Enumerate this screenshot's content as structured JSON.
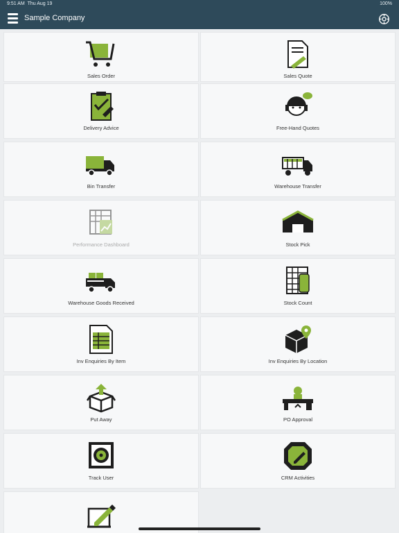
{
  "status": {
    "time": "9:51 AM",
    "date": "Thu Aug 19",
    "battery": "100%"
  },
  "header": {
    "title": "Sample Company"
  },
  "tiles": [
    {
      "label": "Sales Order",
      "icon": "cart-icon"
    },
    {
      "label": "Sales Quote",
      "icon": "quote-document-icon"
    },
    {
      "label": "Delivery Advice",
      "icon": "clipboard-checklist-icon"
    },
    {
      "label": "Free-Hand Quotes",
      "icon": "headset-operator-icon"
    },
    {
      "label": "Bin Transfer",
      "icon": "truck-icon"
    },
    {
      "label": "Warehouse Transfer",
      "icon": "container-truck-icon"
    },
    {
      "label": "Performance Dashboard",
      "icon": "dashboard-chart-icon"
    },
    {
      "label": "Stock Pick",
      "icon": "warehouse-icon"
    },
    {
      "label": "Warehouse Goods Received",
      "icon": "delivery-truck-boxes-icon"
    },
    {
      "label": "Stock Count",
      "icon": "stock-count-sheet-icon"
    },
    {
      "label": "Inv Enquiries By Item",
      "icon": "item-document-icon"
    },
    {
      "label": "Inv Enquiries By Location",
      "icon": "box-location-pin-icon"
    },
    {
      "label": "Put Away",
      "icon": "open-box-arrow-icon"
    },
    {
      "label": "PO Approval",
      "icon": "desk-person-icon"
    },
    {
      "label": "Track User",
      "icon": "target-tracking-icon"
    },
    {
      "label": "CRM Activities",
      "icon": "crm-edit-icon"
    },
    {
      "label": "",
      "icon": "signature-pad-icon"
    }
  ],
  "colors": {
    "nav": "#2e4a5a",
    "accent": "#8ab43a",
    "dark": "#1e1e1e"
  }
}
